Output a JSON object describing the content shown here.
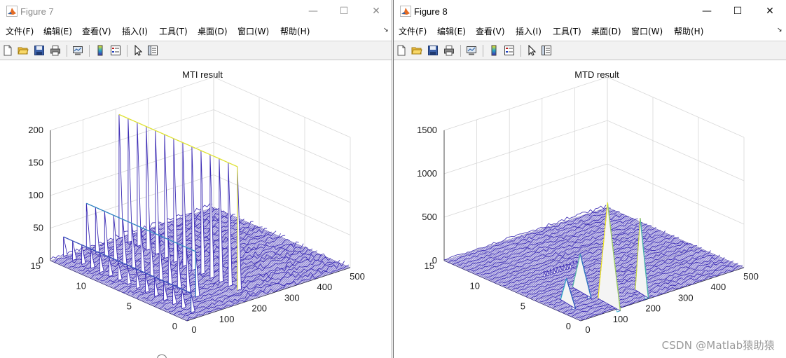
{
  "windows": [
    {
      "id": "win7",
      "title": "Figure 7",
      "active": false,
      "controls": {
        "minimize": "—",
        "maximize": "☐",
        "close": "✕"
      },
      "menus": [
        "文件(F)",
        "编辑(E)",
        "查看(V)",
        "插入(I)",
        "工具(T)",
        "桌面(D)",
        "窗口(W)",
        "帮助(H)"
      ],
      "menu_overflow": "↘"
    },
    {
      "id": "win8",
      "title": "Figure 8",
      "active": true,
      "controls": {
        "minimize": "—",
        "maximize": "☐",
        "close": "✕"
      },
      "menus": [
        "文件(F)",
        "编辑(E)",
        "查看(V)",
        "插入(I)",
        "工具(T)",
        "桌面(D)",
        "窗口(W)",
        "帮助(H)"
      ],
      "menu_overflow": "↘"
    }
  ],
  "toolbar_icons": [
    "new-figure-icon",
    "open-folder-icon",
    "save-icon",
    "print-icon",
    "link-plot-icon",
    "colorbar-icon",
    "legend-icon",
    "edit-pointer-icon",
    "property-inspector-icon"
  ],
  "colors": {
    "surface_low": "#3c2cb4",
    "surface_mid": "#2aa8c8",
    "surface_high": "#f2e81e",
    "surface_fill": "#ffffff"
  },
  "chart_data": [
    {
      "type": "surface-3d",
      "title": "MTI  result",
      "z_ticks": [
        "0",
        "50",
        "100",
        "150",
        "200"
      ],
      "zlim": [
        0,
        200
      ],
      "x_ticks": [
        "0",
        "100",
        "200",
        "300",
        "400",
        "500"
      ],
      "xlim": [
        0,
        500
      ],
      "y_ticks": [
        "0",
        "5",
        "10",
        "15"
      ],
      "ylim": [
        0,
        15
      ],
      "grid": true,
      "ridges": [
        {
          "range_bin": 210,
          "peak": 190,
          "pulses": [
            2,
            15
          ]
        },
        {
          "range_bin": 110,
          "peak": 70,
          "pulses": [
            3,
            15
          ]
        },
        {
          "range_bin": 40,
          "peak": 30,
          "pulses": [
            1,
            15
          ]
        }
      ],
      "noise_level": 5
    },
    {
      "type": "surface-3d",
      "title": "MTD  result",
      "z_ticks": [
        "0",
        "500",
        "1000",
        "1500"
      ],
      "zlim": [
        0,
        1500
      ],
      "x_ticks": [
        "0",
        "100",
        "200",
        "300",
        "400",
        "500"
      ],
      "xlim": [
        0,
        500
      ],
      "y_ticks": [
        "0",
        "5",
        "10",
        "15"
      ],
      "ylim": [
        0,
        15
      ],
      "grid": true,
      "peaks": [
        {
          "range_bin": 110,
          "doppler": 1,
          "value": 1180,
          "width": 1.4
        },
        {
          "range_bin": 210,
          "doppler": 1,
          "value": 880,
          "width": 0.9
        },
        {
          "range_bin": 110,
          "doppler": 4,
          "value": 450,
          "width": 1.2
        },
        {
          "range_bin": 40,
          "doppler": 3,
          "value": 300,
          "width": 1.0
        }
      ],
      "noise_level": 25
    }
  ],
  "watermark": "CSDN @Matlab猿助猿"
}
